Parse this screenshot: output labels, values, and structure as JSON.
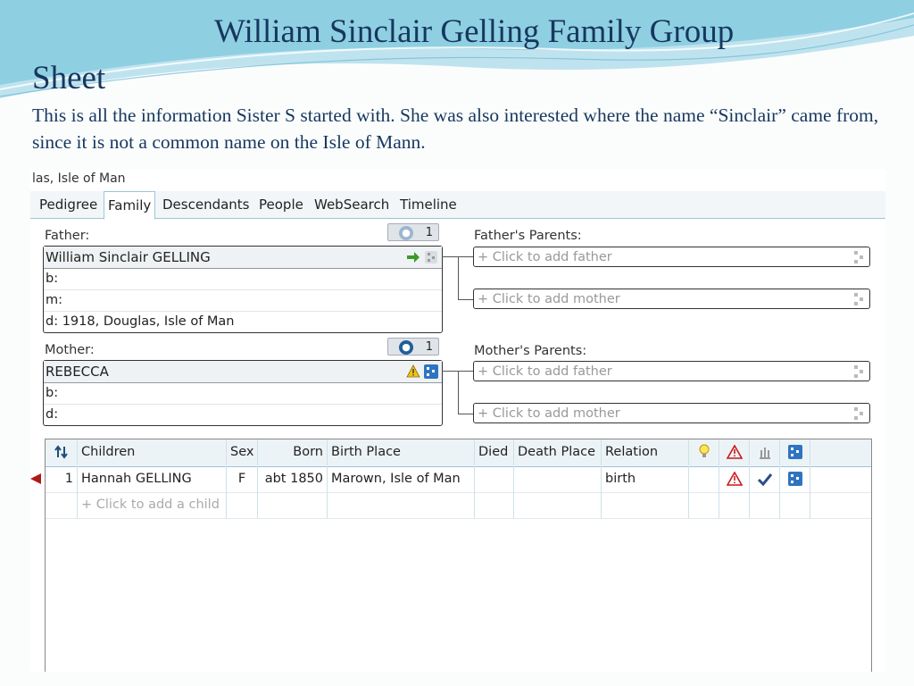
{
  "slide": {
    "title_line1": "William Sinclair Gelling Family Group",
    "title_line2": "Sheet",
    "description": "This is all the information Sister S started with. She was also interested where the name “Sinclair” came from, since it is not a common name on the Isle of Mann."
  },
  "app": {
    "location_fragment": "las, Isle of Man",
    "tabs": [
      "Pedigree",
      "Family",
      "Descendants",
      "People",
      "WebSearch",
      "Timeline"
    ],
    "active_tab": "Family",
    "father": {
      "label": "Father:",
      "name": "William Sinclair GELLING",
      "birth": "b:",
      "marriage": "m:",
      "death": "d: 1918, Douglas, Isle of Man",
      "spouse_count": "1"
    },
    "mother": {
      "label": "Mother:",
      "name": "REBECCA",
      "birth": "b:",
      "death": "d:",
      "spouse_count": "1"
    },
    "fathers_parents": {
      "label": "Father's Parents:",
      "add_father": "+ Click to add father",
      "add_mother": "+ Click to add mother"
    },
    "mothers_parents": {
      "label": "Mother's Parents:",
      "add_father": "+ Click to add father",
      "add_mother": "+ Click to add mother"
    },
    "children_grid": {
      "columns": [
        "Children",
        "Sex",
        "Born",
        "Birth Place",
        "Died",
        "Death Place",
        "Relation"
      ],
      "rows": [
        {
          "num": "1",
          "name": "Hannah GELLING",
          "sex": "F",
          "born": "abt 1850",
          "birth_place": "Marown, Isle of Man",
          "died": "",
          "death_place": "",
          "relation": "birth"
        }
      ],
      "add_child": "+ Click to add a child"
    },
    "colors": {
      "accent": "#17375e",
      "tab_border": "#9cc6d8",
      "warning": "#c8191c",
      "tree_icon": "#2f74c0"
    }
  }
}
